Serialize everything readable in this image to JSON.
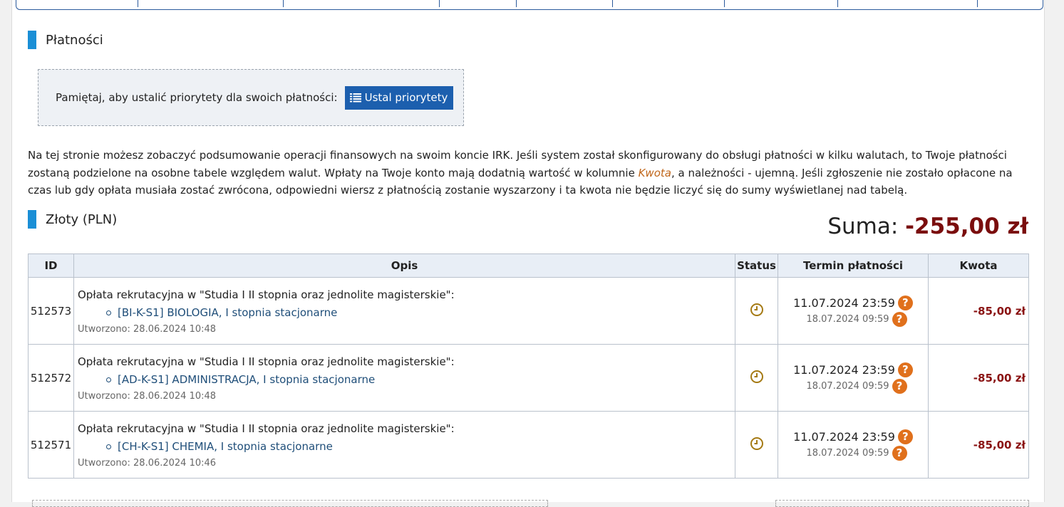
{
  "section_payments": "Płatności",
  "notice": {
    "message": "Pamiętaj, aby ustalić priorytety dla swoich płatności:",
    "button": "Ustal priorytety"
  },
  "description": {
    "part1": "Na tej stronie możesz zobaczyć podsumowanie operacji finansowych na swoim koncie IRK. Jeśli system został skonfigurowany do obsługi płatności w kilku walutach, to Twoje płatności zostaną podzielone na osobne tabele względem walut. Wpłaty na Twoje konto mają dodatnią wartość w kolumnie ",
    "highlight": "Kwota",
    "part2": ", a należności - ujemną. Jeśli zgłoszenie nie zostało opłacone na czas lub gdy opłata musiała zostać zwrócona, odpowiedni wiersz z płatnością zostanie wyszarzony i ta kwota nie będzie liczyć się do sumy wyświetlanej nad tabelą."
  },
  "currency_section": "Złoty (PLN)",
  "suma": {
    "label": "Suma:",
    "value": "-255,00 zł"
  },
  "table": {
    "headers": {
      "id": "ID",
      "opis": "Opis",
      "status": "Status",
      "termin": "Termin płatności",
      "kwota": "Kwota"
    },
    "rows": [
      {
        "id": "512573",
        "title": "Opłata rekrutacyjna w \"Studia I II stopnia oraz jednolite magisterskie\":",
        "course": "[BI-K-S1] BIOLOGIA, I stopnia stacjonarne",
        "created": "Utworzono: 28.06.2024 10:48",
        "termin": "11.07.2024 23:59",
        "termin2": "18.07.2024 09:59",
        "kwota": "-85,00 zł"
      },
      {
        "id": "512572",
        "title": "Opłata rekrutacyjna w \"Studia I II stopnia oraz jednolite magisterskie\":",
        "course": "[AD-K-S1] ADMINISTRACJA, I stopnia stacjonarne",
        "created": "Utworzono: 28.06.2024 10:48",
        "termin": "11.07.2024 23:59",
        "termin2": "18.07.2024 09:59",
        "kwota": "-85,00 zł"
      },
      {
        "id": "512571",
        "title": "Opłata rekrutacyjna w \"Studia I II stopnia oraz jednolite magisterskie\":",
        "course": "[CH-K-S1] CHEMIA, I stopnia stacjonarne",
        "created": "Utworzono: 28.06.2024 10:46",
        "termin": "11.07.2024 23:59",
        "termin2": "18.07.2024 09:59",
        "kwota": "-85,00 zł"
      }
    ]
  },
  "icons": {
    "status": "clock-icon",
    "help": "question-circle-icon",
    "button": "list-icon"
  },
  "colors": {
    "accent": "#1a8fd6",
    "button": "#1c5fae",
    "negative": "#8a1212",
    "help": "#e0701c",
    "status": "#a57a14"
  }
}
